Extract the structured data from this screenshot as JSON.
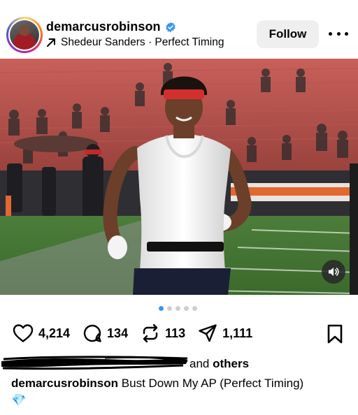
{
  "header": {
    "username": "demarcusrobinson",
    "audio_label": "Shedeur Sanders · Perfect Timing",
    "follow_label": "Follow",
    "icons": {
      "verified": "verified-badge-icon",
      "audio": "arrow-up-right-icon",
      "more": "more-horizontal-icon",
      "avatar": "profile-avatar"
    },
    "accent_color": "#3897f0"
  },
  "post": {
    "image_subject": "player-warmup-photo",
    "carousel": {
      "count": 5,
      "active_index": 0
    },
    "mute_icon": "volume-icon"
  },
  "actions": {
    "likes": "4,214",
    "comments": "134",
    "reposts": "113",
    "shares": "1,111",
    "icons": [
      "heart-icon",
      "comment-icon",
      "repost-icon",
      "share-icon",
      "bookmark-icon"
    ]
  },
  "liked_by": {
    "and_label": "and",
    "others_label": "others"
  },
  "caption": {
    "username": "demarcusrobinson",
    "text": "Bust Down My AP (Perfect Timing)",
    "emoji": "💎"
  }
}
